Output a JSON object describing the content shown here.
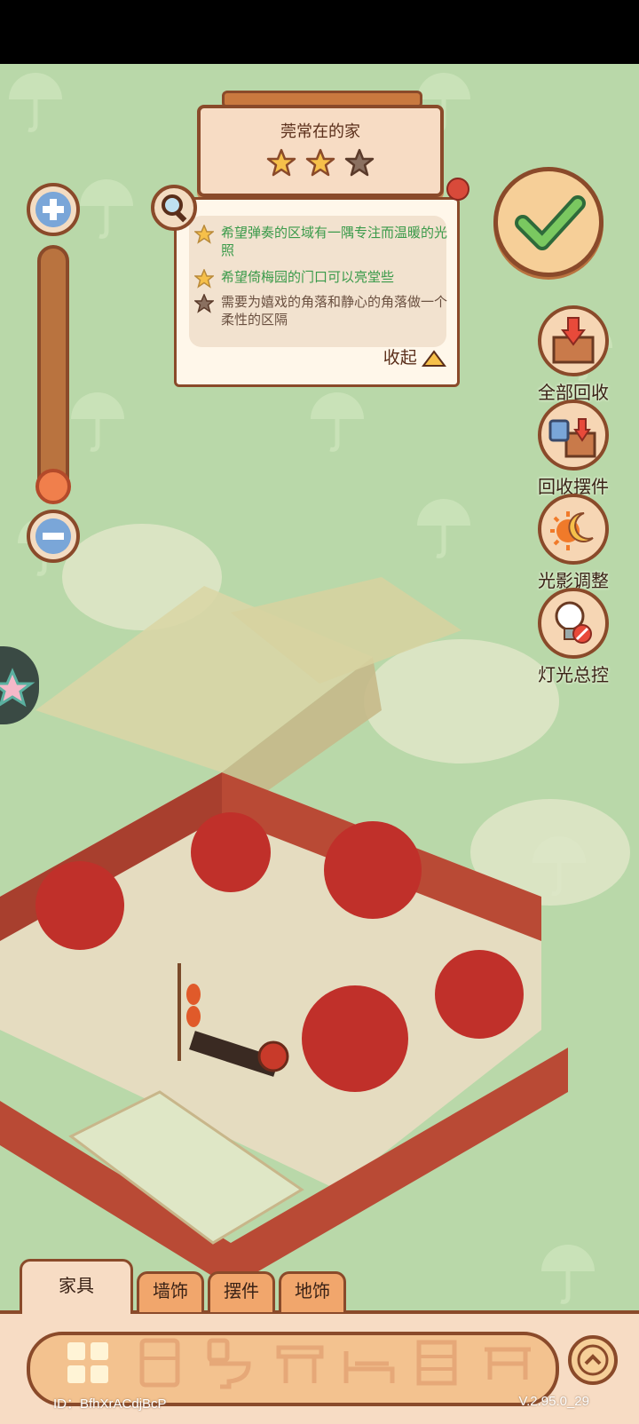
{
  "home": {
    "title": "莞常在的家",
    "stars_earned": 2,
    "stars_total": 3
  },
  "tasks": {
    "items": [
      {
        "text": "希望弹奏的区域有一隅专注而温暖的光照",
        "done": true
      },
      {
        "text": "希望倚梅园的门口可以亮堂些",
        "done": true
      },
      {
        "text": "需要为嬉戏的角落和静心的角落做一个柔性的区隔",
        "done": false
      }
    ],
    "collapse_label": "收起"
  },
  "tools": {
    "recycle_all": "全部回收",
    "recycle_decor": "回收摆件",
    "light_shadow": "光影调整",
    "light_control": "灯光总控"
  },
  "tabs": {
    "furniture": "家具",
    "wall_decor": "墙饰",
    "ornaments": "摆件",
    "floor_decor": "地饰"
  },
  "footer": {
    "id": "ID：BfhXrACdjBcP",
    "version": "V.2.95.0_29"
  },
  "colors": {
    "background": "#b9d8a9",
    "wood_dark": "#8a4a2a",
    "panel": "#f7dcc4",
    "done_text": "#3a9a4a",
    "pending_text": "#6a5040",
    "star_gold": "#f6c04a"
  }
}
